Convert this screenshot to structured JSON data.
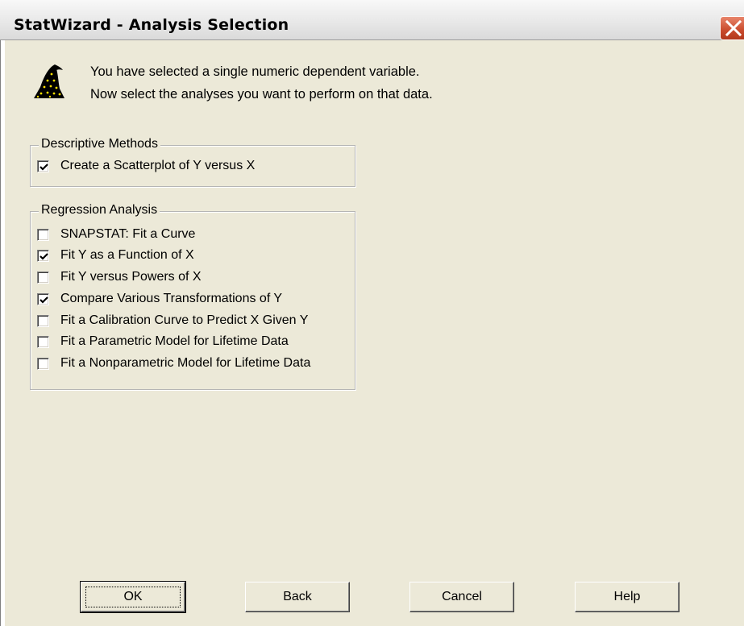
{
  "window": {
    "title": "StatWizard - Analysis Selection"
  },
  "intro": {
    "icon": "wizard-hat-icon",
    "line1": "You have selected a single numeric dependent variable.",
    "line2": "Now select the analyses you want to perform on that data."
  },
  "descriptive": {
    "legend": "Descriptive Methods",
    "options": [
      {
        "label": "Create a Scatterplot of Y versus X",
        "checked": true
      }
    ]
  },
  "regression": {
    "legend": "Regression Analysis",
    "options": [
      {
        "label": "SNAPSTAT: Fit a Curve",
        "checked": false
      },
      {
        "label": "Fit Y as a Function of X",
        "checked": true
      },
      {
        "label": "Fit Y versus Powers of X",
        "checked": false
      },
      {
        "label": "Compare Various Transformations of Y",
        "checked": true
      },
      {
        "label": "Fit a Calibration Curve to Predict X Given Y",
        "checked": false
      },
      {
        "label": "Fit a Parametric Model for Lifetime Data",
        "checked": false
      },
      {
        "label": "Fit a Nonparametric Model for Lifetime Data",
        "checked": false
      }
    ]
  },
  "buttons": {
    "ok": "OK",
    "back": "Back",
    "cancel": "Cancel",
    "help": "Help"
  },
  "colors": {
    "dialog_bg": "#ece9d8",
    "close_button": "#c94a2c",
    "hat": "#000000",
    "stars": "#ffe000"
  }
}
